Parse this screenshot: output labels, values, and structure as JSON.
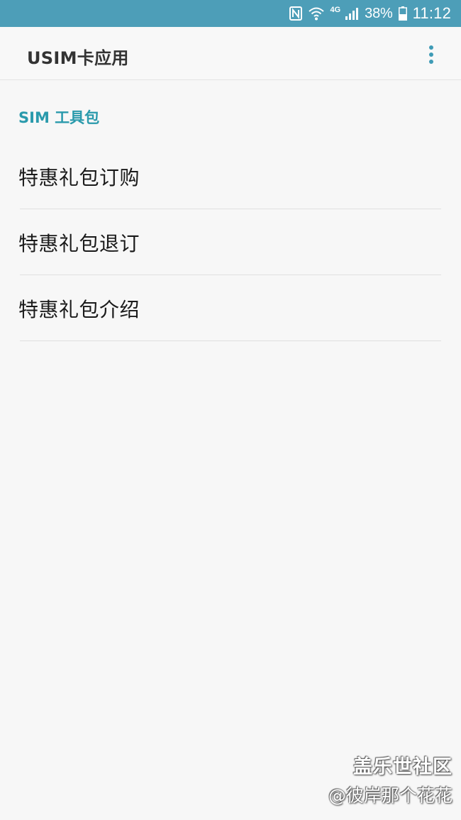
{
  "status_bar": {
    "network_type": "4G",
    "battery_percent": "38%",
    "time": "11:12",
    "icons": [
      "nfc-icon",
      "wifi-icon",
      "signal-icon",
      "battery-icon"
    ]
  },
  "app_bar": {
    "title": "USIM卡应用",
    "menu_icon": "more-vert-icon"
  },
  "section": {
    "header": "SIM 工具包"
  },
  "menu_items": [
    {
      "label": "特惠礼包订购"
    },
    {
      "label": "特惠礼包退订"
    },
    {
      "label": "特惠礼包介绍"
    }
  ],
  "watermark": {
    "title": "盖乐世社区",
    "user": "@彼岸那个花花"
  },
  "colors": {
    "status_bar_bg": "#4d9eb8",
    "accent": "#2a9aac",
    "background": "#f7f7f7",
    "text": "#1a1a1a"
  }
}
